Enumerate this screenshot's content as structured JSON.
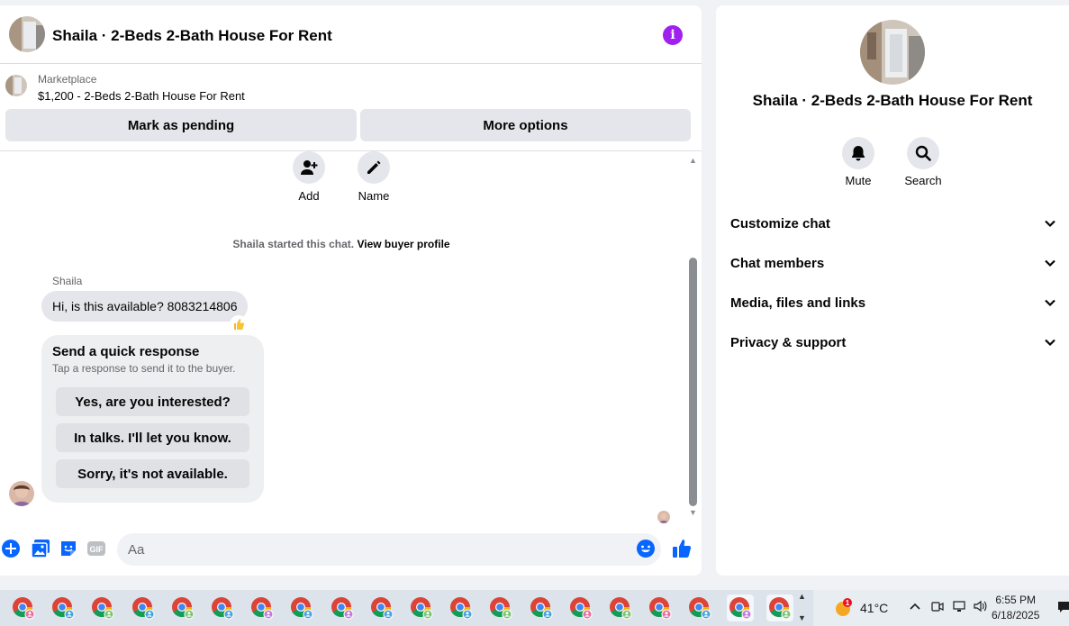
{
  "chat": {
    "header_title": "Shaila · 2-Beds 2-Bath House For Rent",
    "info_icon": "info-icon",
    "listing": {
      "source": "Marketplace",
      "title": "$1,200 - 2-Beds 2-Bath House For Rent"
    },
    "buttons": {
      "mark_pending": "Mark as pending",
      "more_options": "More options"
    },
    "group_actions": [
      {
        "label": "Add",
        "icon": "add-person-icon"
      },
      {
        "label": "Name",
        "icon": "pencil-icon"
      }
    ],
    "started_text": "Shaila started this chat.",
    "view_profile_link": "View buyer profile",
    "message": {
      "sender": "Shaila",
      "text": "Hi, is this available? 8083214806",
      "reaction": "thumbs-up"
    },
    "quick_response": {
      "title": "Send a quick response",
      "subtitle": "Tap a response to send it to the buyer.",
      "options": [
        "Yes, are you interested?",
        "In talks. I'll let you know.",
        "Sorry, it's not available."
      ]
    },
    "composer": {
      "placeholder": "Aa"
    }
  },
  "details": {
    "title": "Shaila · 2-Beds 2-Bath House For Rent",
    "actions": [
      {
        "label": "Mute",
        "icon": "bell-icon"
      },
      {
        "label": "Search",
        "icon": "search-icon"
      }
    ],
    "sections": [
      "Customize chat",
      "Chat members",
      "Media, files and links",
      "Privacy & support"
    ]
  },
  "taskbar": {
    "temperature": "41°C",
    "weather_badge": "1",
    "time": "6:55 PM",
    "date": "6/18/2025"
  },
  "colors": {
    "accent_blue": "#0866ff",
    "info_purple": "#a020f0",
    "bubble_gray": "#e4e6eb"
  }
}
